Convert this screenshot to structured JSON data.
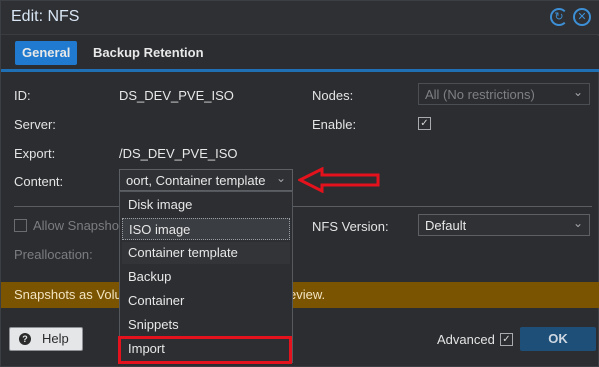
{
  "title": "Edit: NFS",
  "tabs": [
    {
      "label": "General"
    },
    {
      "label": "Backup Retention"
    }
  ],
  "form": {
    "id_label": "ID:",
    "id_value": "DS_DEV_PVE_ISO",
    "server_label": "Server:",
    "server_value": "",
    "export_label": "Export:",
    "export_value": "/DS_DEV_PVE_ISO",
    "content_label": "Content:",
    "content_value": "oort, Container template",
    "nodes_label": "Nodes:",
    "nodes_value": "All (No restrictions)",
    "enable_label": "Enable:",
    "allow_snapshots_label": "Allow Snapshots",
    "nfs_version_label": "NFS Version:",
    "nfs_version_value": "Default",
    "preallocation_label": "Preallocation:"
  },
  "warning": {
    "text_left": "Snapshots as Volu",
    "text_right": "eview."
  },
  "dropdown": {
    "options": [
      "Disk image",
      "ISO image",
      "Container template",
      "Backup",
      "Container",
      "Snippets",
      "Import"
    ]
  },
  "footer": {
    "help_label": "Help",
    "advanced_label": "Advanced",
    "ok_label": "OK"
  },
  "icons": {
    "reset": "reset-icon",
    "close": "close-icon",
    "help": "question-icon",
    "chevron": "chevron-down-icon",
    "check": "checkmark-icon"
  },
  "colors": {
    "accent": "#1f7ad0",
    "warning_bar": "#7a5400",
    "annotation": "#e3121c",
    "ok_button": "#1d4f78"
  }
}
